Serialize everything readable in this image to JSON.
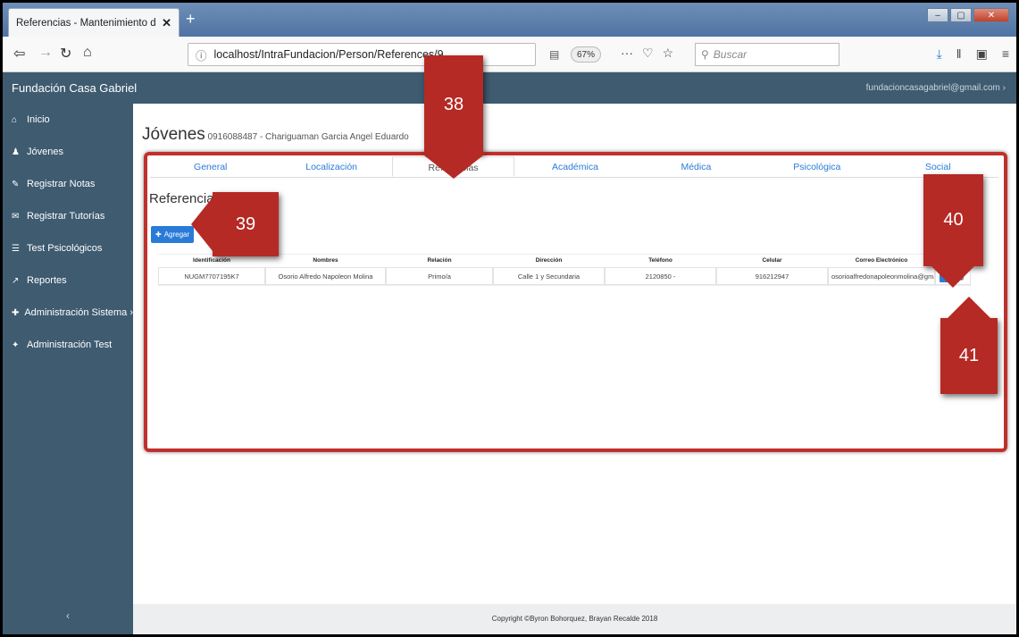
{
  "browser": {
    "tab_title": "Referencias - Mantenimiento de Jó",
    "tab_close": "✕",
    "new_tab": "+",
    "url_info": "ⓘ",
    "url": "localhost/IntraFundacion/Person/References/9",
    "zoom": "67%",
    "search_placeholder": "Buscar",
    "win_min": "–",
    "win_max": "▢",
    "win_close": "✕"
  },
  "app": {
    "brand": "Fundación Casa Gabriel",
    "account": "fundacioncasagabriel@gmail.com  ›"
  },
  "sidebar": {
    "items": [
      {
        "icon": "home-icon",
        "glyph": "⌂",
        "label": "Inicio"
      },
      {
        "icon": "user-icon",
        "glyph": "♟",
        "label": "Jóvenes"
      },
      {
        "icon": "edit-icon",
        "glyph": "✎",
        "label": "Registrar Notas"
      },
      {
        "icon": "tutor-icon",
        "glyph": "✉",
        "label": "Registrar Tutorías"
      },
      {
        "icon": "list-icon",
        "glyph": "☰",
        "label": "Test Psicológicos"
      },
      {
        "icon": "chart-icon",
        "glyph": "↗",
        "label": "Reportes"
      },
      {
        "icon": "wrench-icon",
        "glyph": "✚",
        "label": "Administración Sistema  ›"
      },
      {
        "icon": "test-icon",
        "glyph": "✦",
        "label": "Administración Test"
      }
    ],
    "collapse": "‹"
  },
  "page": {
    "title": "Jóvenes",
    "subtitle": " 0916088487 - Chariguaman Garcia Angel Eduardo",
    "tabs": [
      "General",
      "Localización",
      "Referencias",
      "Académica",
      "Médica",
      "Psicológica",
      "Social"
    ],
    "active_tab": "Referencias",
    "section": "Referencias",
    "add_button": "Agregar"
  },
  "table": {
    "headers": [
      "Identificación",
      "Nombres",
      "Relación",
      "Dirección",
      "Teléfono",
      "Celular",
      "Correo Electrónico",
      ""
    ],
    "rows": [
      [
        "NUGM7707195K7",
        "Osorio Alfredo Napoleon Molina",
        "Primo/a",
        "Calle 1 y Secundaria",
        "2120850 -",
        "916212947",
        "osorioalfredonapoleonmolina@gmai"
      ]
    ]
  },
  "footer": "Copyright ©Byron Bohorquez, Brayan Recalde 2018",
  "callouts": [
    "38",
    "39",
    "40",
    "41"
  ],
  "colors": {
    "sidebar": "#3e5b70",
    "accent": "#2a7bd8",
    "callout": "#b52a25"
  }
}
